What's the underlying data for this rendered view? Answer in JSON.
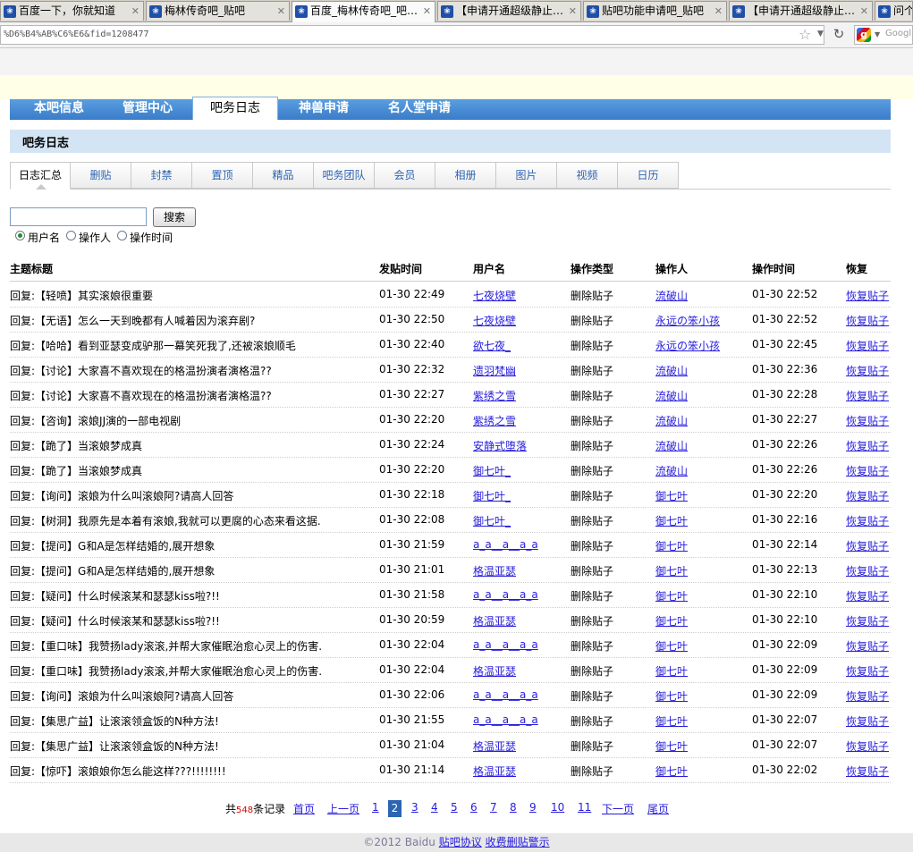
{
  "browser": {
    "tabs": [
      {
        "title": "百度一下，你就知道",
        "active": false
      },
      {
        "title": "梅林传奇吧_贴吧",
        "active": false
      },
      {
        "title": "百度_梅林传奇吧_吧…",
        "active": true
      },
      {
        "title": "【申请开通超级静止…",
        "active": false
      },
      {
        "title": "贴吧功能申请吧_贴吧",
        "active": false
      },
      {
        "title": "【申请开通超级静止…",
        "active": false
      },
      {
        "title": "问个",
        "active": false
      }
    ],
    "url": "%D6%B4%AB%C6%E6&fid=1208477",
    "search_placeholder": "Googl"
  },
  "nav": {
    "items": [
      "本吧信息",
      "管理中心",
      "吧务日志",
      "神兽申请",
      "名人堂申请"
    ],
    "active": "吧务日志"
  },
  "section_title": "吧务日志",
  "subtabs": [
    "日志汇总",
    "删贴",
    "封禁",
    "置顶",
    "精品",
    "吧务团队",
    "会员",
    "相册",
    "图片",
    "视频",
    "日历"
  ],
  "search": {
    "value": "",
    "button": "搜索",
    "options": [
      "用户名",
      "操作人",
      "操作时间"
    ],
    "selected": "用户名"
  },
  "table": {
    "headers": [
      "主题标题",
      "发贴时间",
      "用户名",
      "操作类型",
      "操作人",
      "操作时间",
      "恢复"
    ],
    "rows": [
      [
        "回复:【轻喷】其实滚娘很重要",
        "01-30 22:49",
        "七夜烧壁",
        "删除贴子",
        "流破山",
        "01-30 22:52",
        "恢复贴子"
      ],
      [
        "回复:【无语】怎么一天到晚都有人喊着因为滚弃剧?",
        "01-30 22:50",
        "七夜烧壁",
        "删除贴子",
        "永远の笨小孩",
        "01-30 22:52",
        "恢复贴子"
      ],
      [
        "回复:【哈哈】看到亚瑟变成驴那一幕笑死我了,还被滚娘顺毛",
        "01-30 22:40",
        "欲七夜_",
        "删除贴子",
        "永远の笨小孩",
        "01-30 22:45",
        "恢复贴子"
      ],
      [
        "回复:【讨论】大家喜不喜欢现在的格温扮演者演格温??",
        "01-30 22:32",
        "遗羽梵幽",
        "删除贴子",
        "流破山",
        "01-30 22:36",
        "恢复贴子"
      ],
      [
        "回复:【讨论】大家喜不喜欢现在的格温扮演者演格温??",
        "01-30 22:27",
        "紫绣之雪",
        "删除贴子",
        "流破山",
        "01-30 22:28",
        "恢复贴子"
      ],
      [
        "回复:【咨询】滚娘JJ演的一部电视剧",
        "01-30 22:20",
        "紫绣之雪",
        "删除贴子",
        "流破山",
        "01-30 22:27",
        "恢复贴子"
      ],
      [
        "回复:【跪了】当滚娘梦成真",
        "01-30 22:24",
        "安静式堕落",
        "删除贴子",
        "流破山",
        "01-30 22:26",
        "恢复贴子"
      ],
      [
        "回复:【跪了】当滚娘梦成真",
        "01-30 22:20",
        "御七叶_",
        "删除贴子",
        "流破山",
        "01-30 22:26",
        "恢复贴子"
      ],
      [
        "回复:【询问】滚娘为什么叫滚娘阿?请高人回答",
        "01-30 22:18",
        "御七叶_",
        "删除贴子",
        "御七叶",
        "01-30 22:20",
        "恢复贴子"
      ],
      [
        "回复:【树洞】我原先是本着有滚娘,我就可以更腐的心态来看这据.",
        "01-30 22:08",
        "御七叶_",
        "删除贴子",
        "御七叶",
        "01-30 22:16",
        "恢复贴子"
      ],
      [
        "回复:【提问】G和A是怎样结婚的,展开想象",
        "01-30 21:59",
        "a_a__a__a_a",
        "删除贴子",
        "御七叶",
        "01-30 22:14",
        "恢复贴子"
      ],
      [
        "回复:【提问】G和A是怎样结婚的,展开想象",
        "01-30 21:01",
        "格温亚瑟",
        "删除贴子",
        "御七叶",
        "01-30 22:13",
        "恢复贴子"
      ],
      [
        "回复:【疑问】什么时候滚某和瑟瑟kiss啦?!!",
        "01-30 21:58",
        "a_a__a__a_a",
        "删除贴子",
        "御七叶",
        "01-30 22:10",
        "恢复贴子"
      ],
      [
        "回复:【疑问】什么时候滚某和瑟瑟kiss啦?!!",
        "01-30 20:59",
        "格温亚瑟",
        "删除贴子",
        "御七叶",
        "01-30 22:10",
        "恢复贴子"
      ],
      [
        "回复:【重口味】我赞扬lady滚滚,并帮大家催眠治愈心灵上的伤害.",
        "01-30 22:04",
        "a_a__a__a_a",
        "删除贴子",
        "御七叶",
        "01-30 22:09",
        "恢复贴子"
      ],
      [
        "回复:【重口味】我赞扬lady滚滚,并帮大家催眠治愈心灵上的伤害.",
        "01-30 22:04",
        "格温亚瑟",
        "删除贴子",
        "御七叶",
        "01-30 22:09",
        "恢复贴子"
      ],
      [
        "回复:【询问】滚娘为什么叫滚娘阿?请高人回答",
        "01-30 22:06",
        "a_a__a__a_a",
        "删除贴子",
        "御七叶",
        "01-30 22:09",
        "恢复贴子"
      ],
      [
        "回复:【集思广益】让滚滚领盒饭的N种方法!",
        "01-30 21:55",
        "a_a__a__a_a",
        "删除贴子",
        "御七叶",
        "01-30 22:07",
        "恢复贴子"
      ],
      [
        "回复:【集思广益】让滚滚领盒饭的N种方法!",
        "01-30 21:04",
        "格温亚瑟",
        "删除贴子",
        "御七叶",
        "01-30 22:07",
        "恢复贴子"
      ],
      [
        "回复:【惊吓】滚娘娘你怎么能这样???!!!!!!!!",
        "01-30 21:14",
        "格温亚瑟",
        "删除贴子",
        "御七叶",
        "01-30 22:02",
        "恢复贴子"
      ]
    ]
  },
  "pager": {
    "total_prefix": "共",
    "total": "548",
    "total_suffix": "条记录",
    "first": "首页",
    "prev": "上一页",
    "pages": [
      "1",
      "2",
      "3",
      "4",
      "5",
      "6",
      "7",
      "8",
      "9",
      "10",
      "11"
    ],
    "current": "2",
    "next": "下一页",
    "last": "尾页"
  },
  "footer": {
    "copyright": "©2012 Baidu",
    "links": [
      "贴吧协议",
      "收费删贴警示"
    ]
  }
}
